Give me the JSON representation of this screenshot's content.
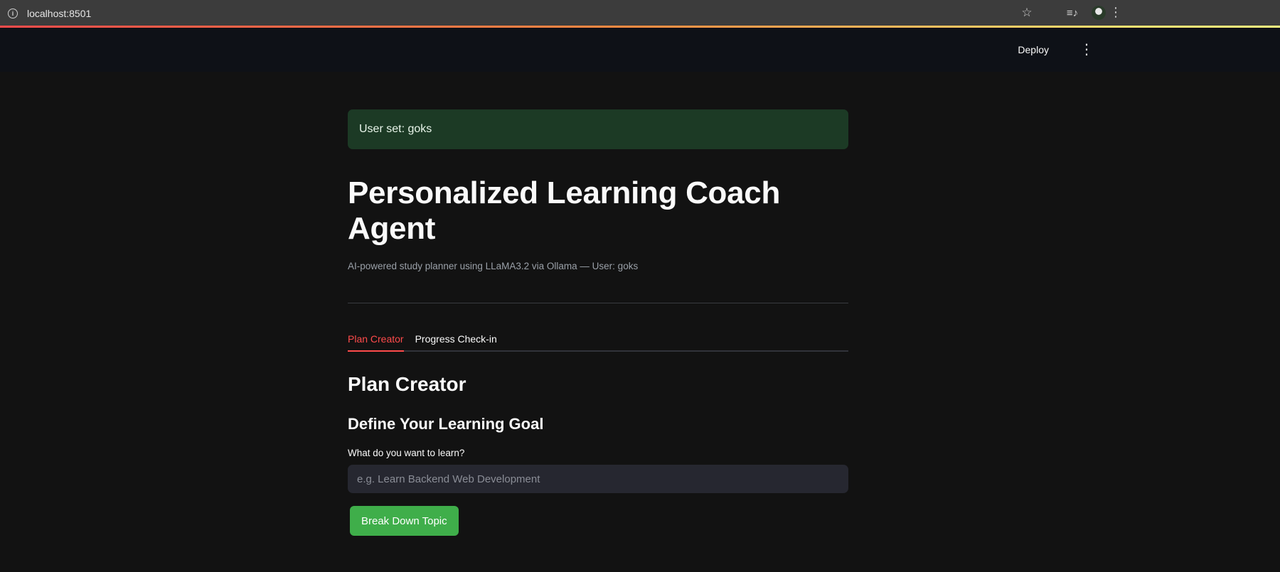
{
  "browser": {
    "url": "localhost:8501",
    "info_icon": "info-icon",
    "icons": [
      "star-icon",
      "playlist-icon",
      "avatar",
      "more-vert-icon"
    ]
  },
  "header": {
    "deploy_label": "Deploy",
    "menu_icon": "more-vert-icon"
  },
  "alert": {
    "text": "User set: goks"
  },
  "page": {
    "title": "Personalized Learning Coach Agent",
    "subtitle": "AI-powered study planner using LLaMA3.2 via Ollama — User: goks"
  },
  "tabs": [
    {
      "label": "Plan Creator",
      "active": true
    },
    {
      "label": "Progress Check-in",
      "active": false
    }
  ],
  "section": {
    "heading": "Plan Creator",
    "subheading": "Define Your Learning Goal",
    "input_label": "What do you want to learn?",
    "input_value": "",
    "input_placeholder": "e.g. Learn Backend Web Development",
    "button_label": "Break Down Topic"
  },
  "colors": {
    "accent": "#ff4b4b",
    "success_bg": "#1c3a25",
    "button": "#3fae4a",
    "background": "#121212"
  }
}
